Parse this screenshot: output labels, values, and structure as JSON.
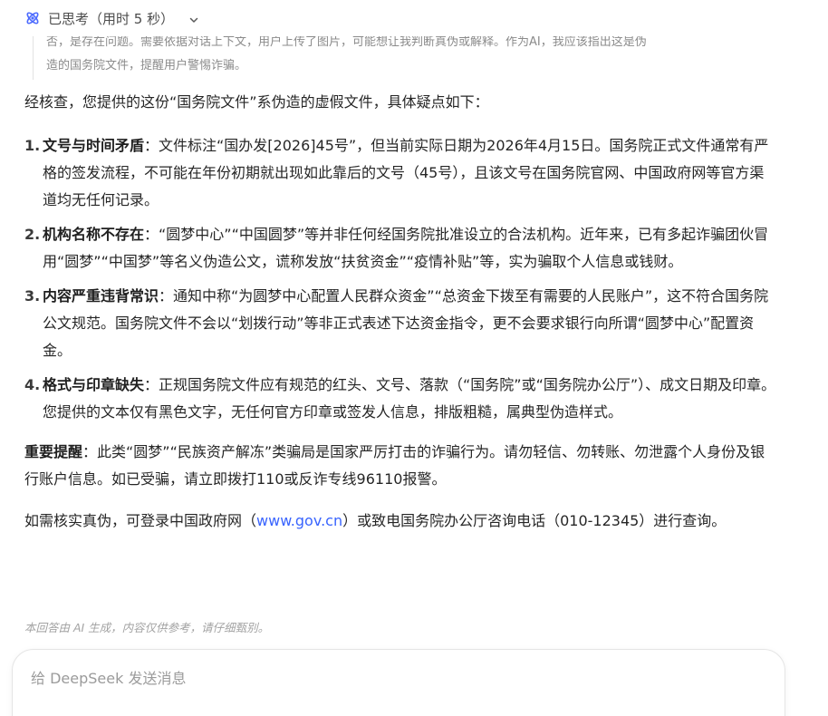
{
  "thinking": {
    "label": "已思考（用时 5 秒）",
    "snippet_partial": "否，是存在问题。需要依据对话上下文，用户上传了图片，可能想让我判断真伪或解释。作为AI，我应该指出这是伪",
    "snippet_last": "造的国务院文件，提醒用户警惕诈骗。"
  },
  "answer": {
    "intro": "经核查，您提供的这份“国务院文件”系伪造的虚假文件，具体疑点如下：",
    "points": [
      {
        "num": "1.",
        "title": "文号与时间矛盾",
        "text": "：文件标注“国办发[2026]45号”，但当前实际日期为2026年4月15日。国务院正式文件通常有严格的签发流程，不可能在年份初期就出现如此靠后的文号（45号），且该文号在国务院官网、中国政府网等官方渠道均无任何记录。"
      },
      {
        "num": "2.",
        "title": "机构名称不存在",
        "text": "：“圆梦中心”“中国圆梦”等并非任何经国务院批准设立的合法机构。近年来，已有多起诈骗团伙冒用“圆梦”“中国梦”等名义伪造公文，谎称发放“扶贫资金”“疫情补贴”等，实为骗取个人信息或钱财。"
      },
      {
        "num": "3.",
        "title": "内容严重违背常识",
        "text": "：通知中称“为圆梦中心配置人民群众资金”“总资金下拨至有需要的人民账户”，这不符合国务院公文规范。国务院文件不会以“划拨行动”等非正式表述下达资金指令，更不会要求银行向所谓“圆梦中心”配置资金。"
      },
      {
        "num": "4.",
        "title": "格式与印章缺失",
        "text": "：正规国务院文件应有规范的红头、文号、落款（“国务院”或“国务院办公厅”）、成文日期及印章。您提供的文本仅有黑色文字，无任何官方印章或签发人信息，排版粗糙，属典型伪造样式。"
      }
    ],
    "warning_title": "重要提醒",
    "warning_text": "：此类“圆梦”“民族资产解冻”类骗局是国家严厉打击的诈骗行为。请勿轻信、勿转账、勿泄露个人身份及银行账户信息。如已受骗，请立即拨打110或反诈专线96110报警。",
    "check_before": "如需核实真伪，可登录中国政府网（",
    "check_link": "www.gov.cn",
    "check_after": "）或致电国务院办公厅咨询电话（010-12345）进行查询。"
  },
  "disclaimer": "本回答由 AI 生成，内容仅供参考，请仔细甄别。",
  "input": {
    "placeholder": "给 DeepSeek 发送消息"
  },
  "colors": {
    "link": "#3964fe",
    "think_icon": "#4d6bfe"
  },
  "icons": {
    "thinking": "atom-icon",
    "toggle": "chevron-down-icon"
  }
}
